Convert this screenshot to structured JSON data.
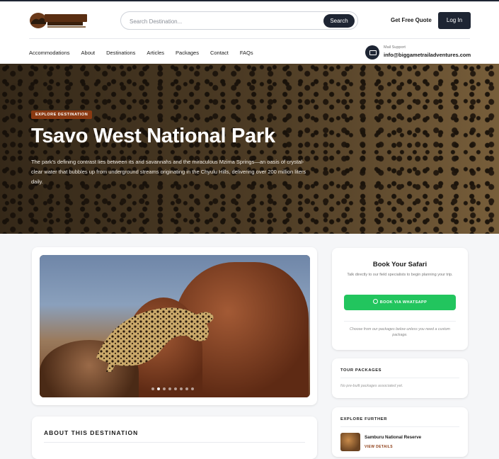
{
  "header": {
    "logo_text": "BEASTGAME TRAIL ADVENTURES",
    "search_placeholder": "Search Destination...",
    "search_button": "Search",
    "quote_label": "Get Free Quote",
    "login_label": "Log In"
  },
  "nav": {
    "items": [
      "Accommodations",
      "About",
      "Destinations",
      "Articles",
      "Packages",
      "Contact",
      "FAQs"
    ]
  },
  "support": {
    "label": "Mail Support",
    "email": "info@biggametrailadventures.com"
  },
  "hero": {
    "badge": "EXPLORE DESTINATION",
    "title": "Tsavo West National Park",
    "description": "The park's defining contrast lies between its arid savannahs and the miraculous Mzima Springs—an oasis of crystal-clear water that bubbles up from underground streams originating in the Chyulu Hills, delivering over 200 million liters daily."
  },
  "gallery": {
    "slide_count": 8,
    "active_index": 1
  },
  "about": {
    "title": "ABOUT THIS DESTINATION"
  },
  "booking": {
    "title": "Book Your Safari",
    "subtitle": "Talk directly to our field specialists to begin planning your trip.",
    "whatsapp_label": "BOOK VIA WHATSAPP",
    "note": "Choose from our packages below unless you need a custom package."
  },
  "packages": {
    "title": "TOUR PACKAGES",
    "empty_text": "No pre-built packages associated yet."
  },
  "explore": {
    "title": "EXPLORE FURTHER",
    "items": [
      {
        "name": "Samburu National Reserve",
        "link": "VIEW DETAILS"
      }
    ]
  },
  "colors": {
    "navy": "#1e2533",
    "accent": "#8b3a12",
    "whatsapp": "#22c55e"
  }
}
